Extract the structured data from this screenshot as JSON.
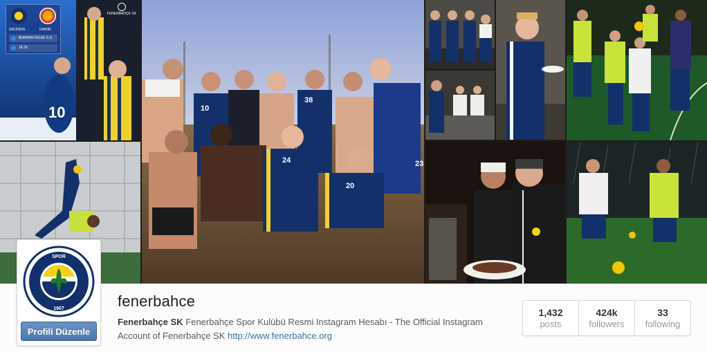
{
  "profile": {
    "username": "fenerbahce",
    "full_name": "Fenerbahçe SK",
    "bio": "Fenerbahçe Spor Kulübü Resmi Instagram Hesabı - The Official Instagram Account of Fenerbahçe SK",
    "website": "http://www.fenerbahce.org",
    "edit_button_label": "Profili Düzenle"
  },
  "stats": [
    {
      "value": "1,432",
      "label": "posts"
    },
    {
      "value": "424k",
      "label": "followers"
    },
    {
      "value": "33",
      "label": "following"
    }
  ],
  "scoreboard": {
    "sponsor_left": "GRUNDIG",
    "sponsor_right": "DAIKIN",
    "venue": "BURHAN FELEK S.S.",
    "time": "18.30",
    "brand": "FENERBAHÇE SK"
  },
  "jerseys": [
    "10",
    "38",
    "24",
    "20",
    "23"
  ],
  "colors": {
    "navy": "#12306b",
    "yellow": "#f7d116",
    "link": "#3b6ea5",
    "button": "#4b77ae"
  }
}
